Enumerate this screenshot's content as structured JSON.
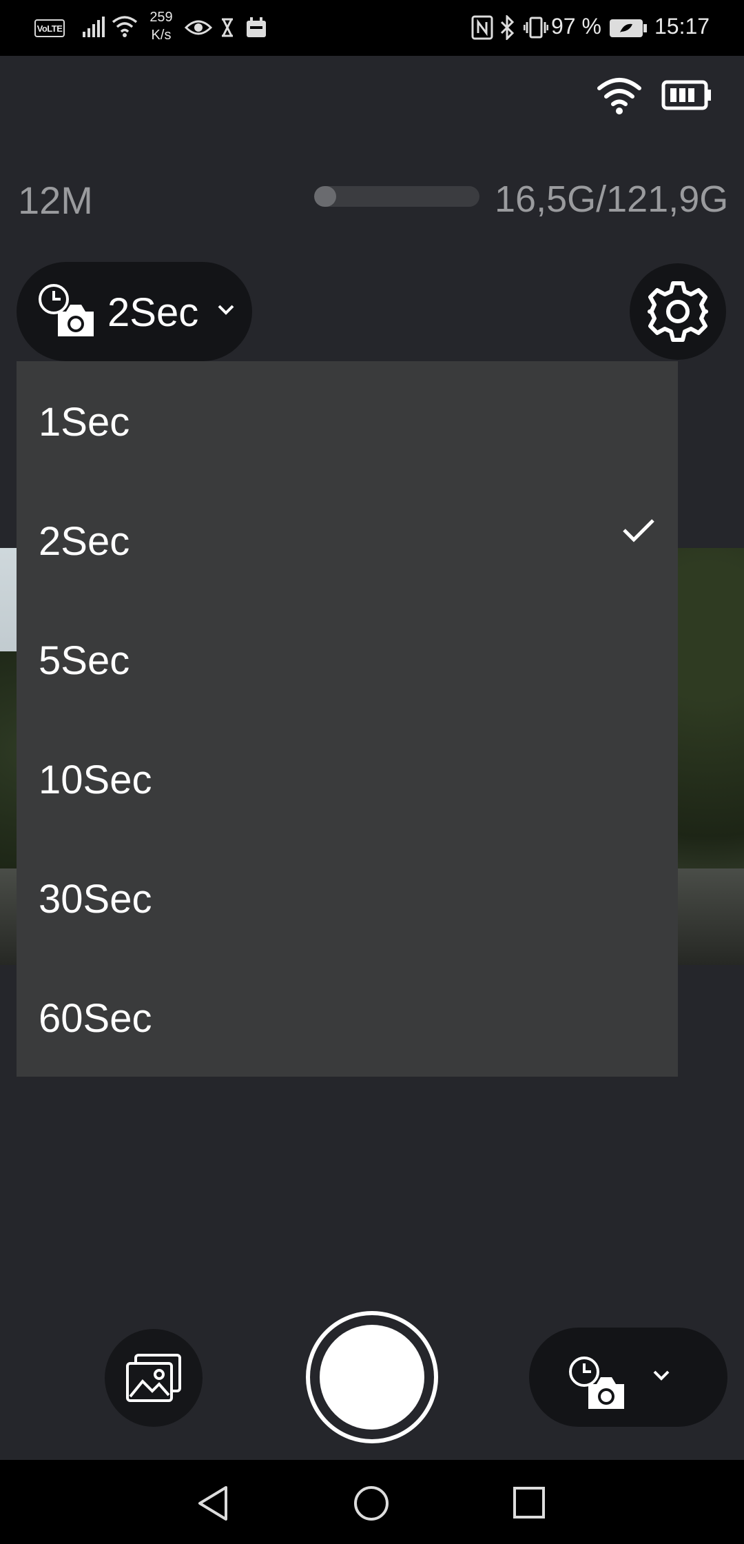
{
  "status_bar": {
    "network_badge": "VoLTE",
    "speed_value": "259",
    "speed_unit": "K/s",
    "battery_percent": "97 %",
    "time": "15:17"
  },
  "camera_info": {
    "resolution": "12M",
    "storage_text": "16,5G/121,9G",
    "storage_used_fraction": 0.135
  },
  "mode_selector": {
    "icon": "timelapse-camera-icon",
    "selected_label": "2Sec"
  },
  "interval_dropdown": {
    "options": [
      "1Sec",
      "2Sec",
      "5Sec",
      "10Sec",
      "30Sec",
      "60Sec"
    ],
    "selected_index": 1
  },
  "icons": {
    "settings": "gear-icon",
    "gallery": "gallery-icon",
    "bottom_mode": "timelapse-camera-icon"
  },
  "colors": {
    "background": "#25262b",
    "dropdown": "#3a3b3c",
    "muted_text": "#9a9b9e"
  }
}
